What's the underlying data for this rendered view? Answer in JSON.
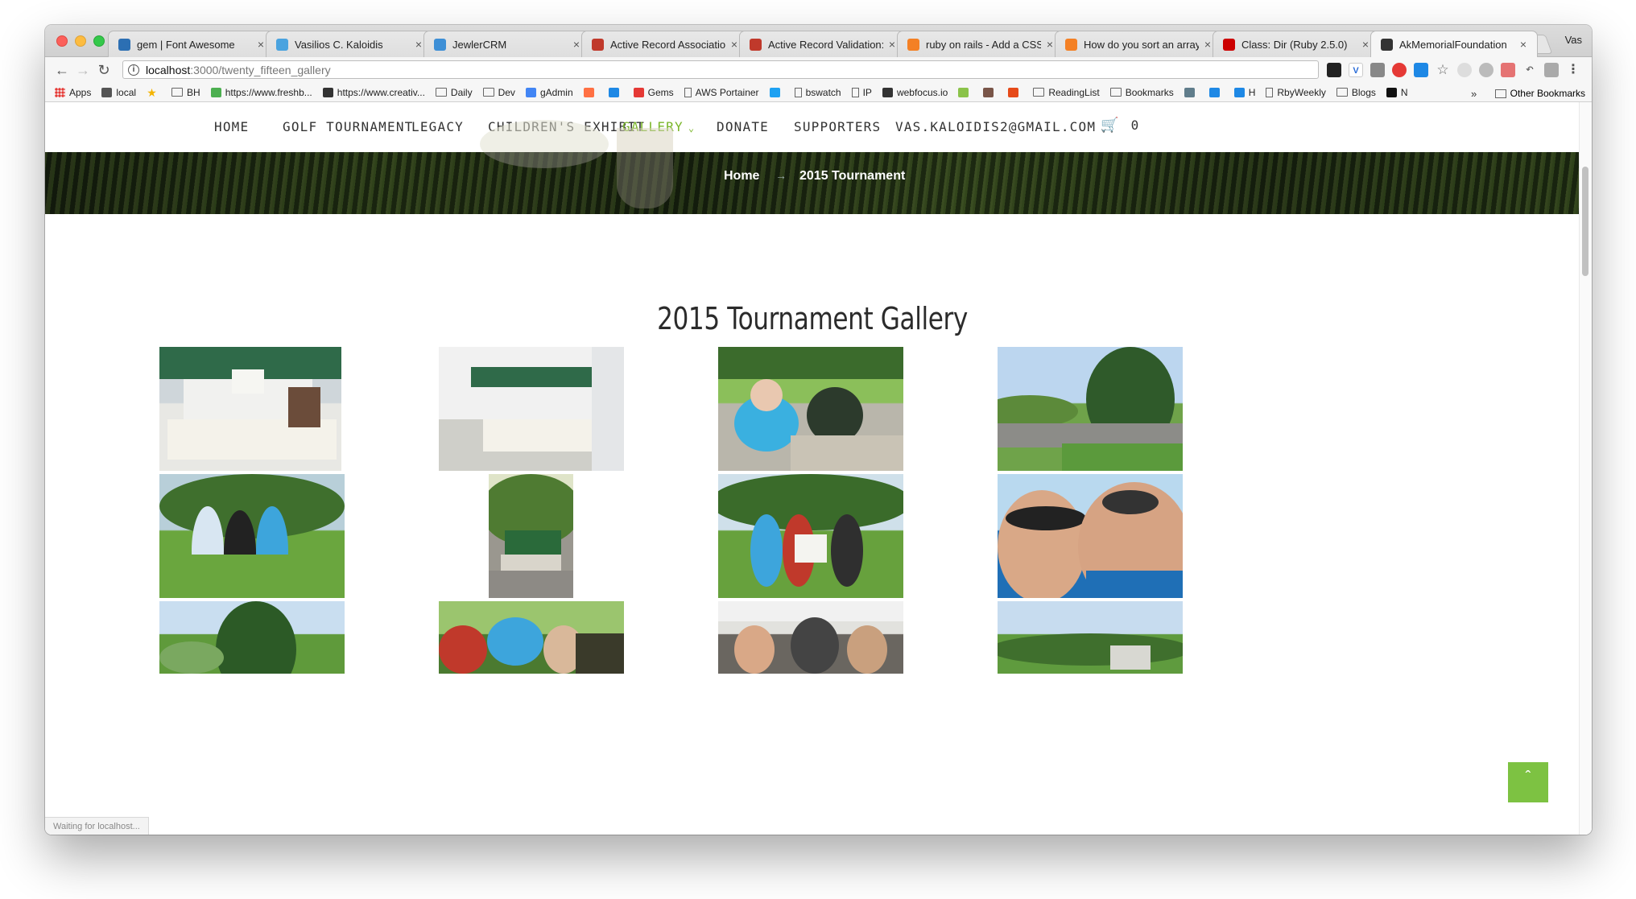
{
  "browser": {
    "tabs": [
      {
        "title": "gem | Font Awesome",
        "favicon_color": "#2c6fb3",
        "active": false
      },
      {
        "title": "Vasilios C. Kaloidis",
        "favicon_color": "#4aa3df",
        "active": false
      },
      {
        "title": "JewlerCRM",
        "favicon_color": "#3d8fd6",
        "active": false
      },
      {
        "title": "Active Record Associatio",
        "favicon_color": "#c0392b",
        "active": false
      },
      {
        "title": "Active Record Validation:",
        "favicon_color": "#c0392b",
        "active": false
      },
      {
        "title": "ruby on rails - Add a CSS",
        "favicon_color": "#f48024",
        "active": false
      },
      {
        "title": "How do you sort an array",
        "favicon_color": "#f48024",
        "active": false
      },
      {
        "title": "Class: Dir (Ruby 2.5.0)",
        "favicon_color": "#cc0000",
        "active": false
      },
      {
        "title": "AkMemorialFoundation",
        "favicon_color": "#333333",
        "active": true
      }
    ],
    "profile": "Vas",
    "url_host": "localhost",
    "url_path": ":3000/twenty_fifteen_gallery",
    "bookmarks": [
      {
        "label": "Apps",
        "kind": "apps"
      },
      {
        "label": "local",
        "kind": "icon"
      },
      {
        "label": "",
        "kind": "star"
      },
      {
        "label": "BH",
        "kind": "folder"
      },
      {
        "label": "https://www.freshb...",
        "kind": "icon"
      },
      {
        "label": "https://www.creativ...",
        "kind": "icon"
      },
      {
        "label": "Daily",
        "kind": "folder"
      },
      {
        "label": "Dev",
        "kind": "folder"
      },
      {
        "label": "gAdmin",
        "kind": "icon"
      },
      {
        "label": "",
        "kind": "icon"
      },
      {
        "label": "",
        "kind": "icon"
      },
      {
        "label": "Gems",
        "kind": "icon"
      },
      {
        "label": "AWS Portainer",
        "kind": "doc"
      },
      {
        "label": "",
        "kind": "icon"
      },
      {
        "label": "bswatch",
        "kind": "doc"
      },
      {
        "label": "IP",
        "kind": "doc"
      },
      {
        "label": "webfocus.io",
        "kind": "icon"
      },
      {
        "label": "",
        "kind": "icon"
      },
      {
        "label": "",
        "kind": "icon"
      },
      {
        "label": "",
        "kind": "icon"
      },
      {
        "label": "ReadingList",
        "kind": "folder"
      },
      {
        "label": "Bookmarks",
        "kind": "folder"
      },
      {
        "label": "",
        "kind": "icon"
      },
      {
        "label": "",
        "kind": "icon"
      },
      {
        "label": "H",
        "kind": "icon"
      },
      {
        "label": "RbyWeekly",
        "kind": "doc"
      },
      {
        "label": "Blogs",
        "kind": "folder"
      },
      {
        "label": "N",
        "kind": "icon"
      }
    ],
    "bookmarks_overflow": "»",
    "other_bookmarks": "Other Bookmarks",
    "status_text": "Waiting for localhost..."
  },
  "site": {
    "nav": [
      {
        "label": "HOME",
        "active": false,
        "dropdown": false
      },
      {
        "label": "GOLF TOURNAMENT",
        "active": false,
        "dropdown": false
      },
      {
        "label": "LEGACY",
        "active": false,
        "dropdown": false
      },
      {
        "label": "CHILDREN'S EXHIBIT",
        "active": false,
        "dropdown": false
      },
      {
        "label": "GALLERY",
        "active": true,
        "dropdown": true
      },
      {
        "label": "DONATE",
        "active": false,
        "dropdown": false
      },
      {
        "label": "SUPPORTERS",
        "active": false,
        "dropdown": false
      },
      {
        "label": "VAS.KALOIDIS2@GMAIL.COM",
        "active": false,
        "dropdown": true
      }
    ],
    "cart_count": "0",
    "breadcrumb": {
      "home": "Home",
      "separator": "→",
      "current": "2015 Tournament"
    },
    "page_title": "2015 Tournament Gallery",
    "accent_color": "#7ab629",
    "back_to_top": "ˆ"
  }
}
